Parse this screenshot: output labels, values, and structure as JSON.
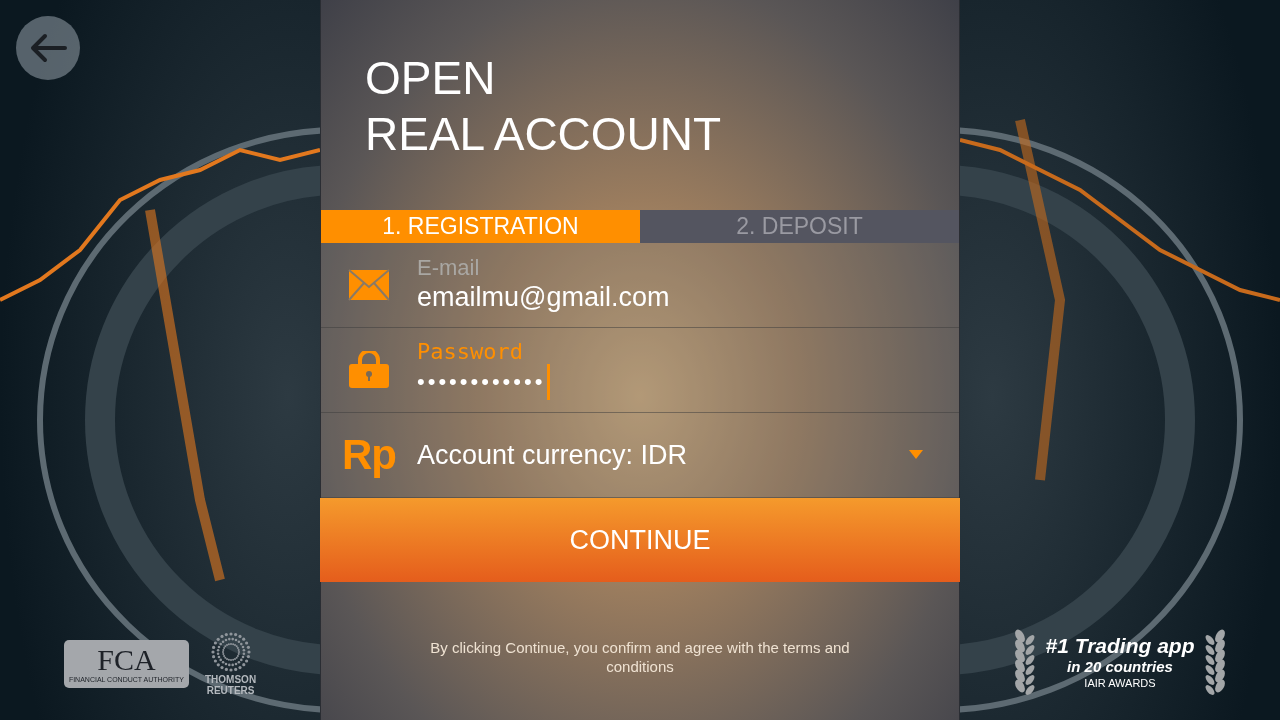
{
  "title": {
    "lines": [
      "OPEN",
      "REAL ACCOUNT"
    ]
  },
  "steps": [
    {
      "label": "1. REGISTRATION",
      "selected": true
    },
    {
      "label": "2. DEPOSIT",
      "selected": false
    }
  ],
  "fields": [
    {
      "kind": "email",
      "label": "E-mail",
      "value": "emailmu@gmail.com",
      "focused": false
    },
    {
      "kind": "password",
      "label": "Password",
      "value": "••••••••••••",
      "focused": true
    },
    {
      "kind": "currency",
      "icon_text": "Rp",
      "value": "Account currency: IDR"
    }
  ],
  "continue_button": {
    "label": "CONTINUE"
  },
  "disclaimer": "By clicking Continue, you confirm and agree with the terms and conditions",
  "regulators": {
    "fca": {
      "letters": "FCA",
      "caption": "FINANCIAL CONDUCT AUTHORITY"
    },
    "thomson_reuters": {
      "lines": [
        "THOMSON",
        "REUTERS"
      ]
    }
  },
  "award": {
    "headline": "#1 Trading app",
    "subline": "in 20 countries",
    "source": "IAIR AWARDS"
  }
}
